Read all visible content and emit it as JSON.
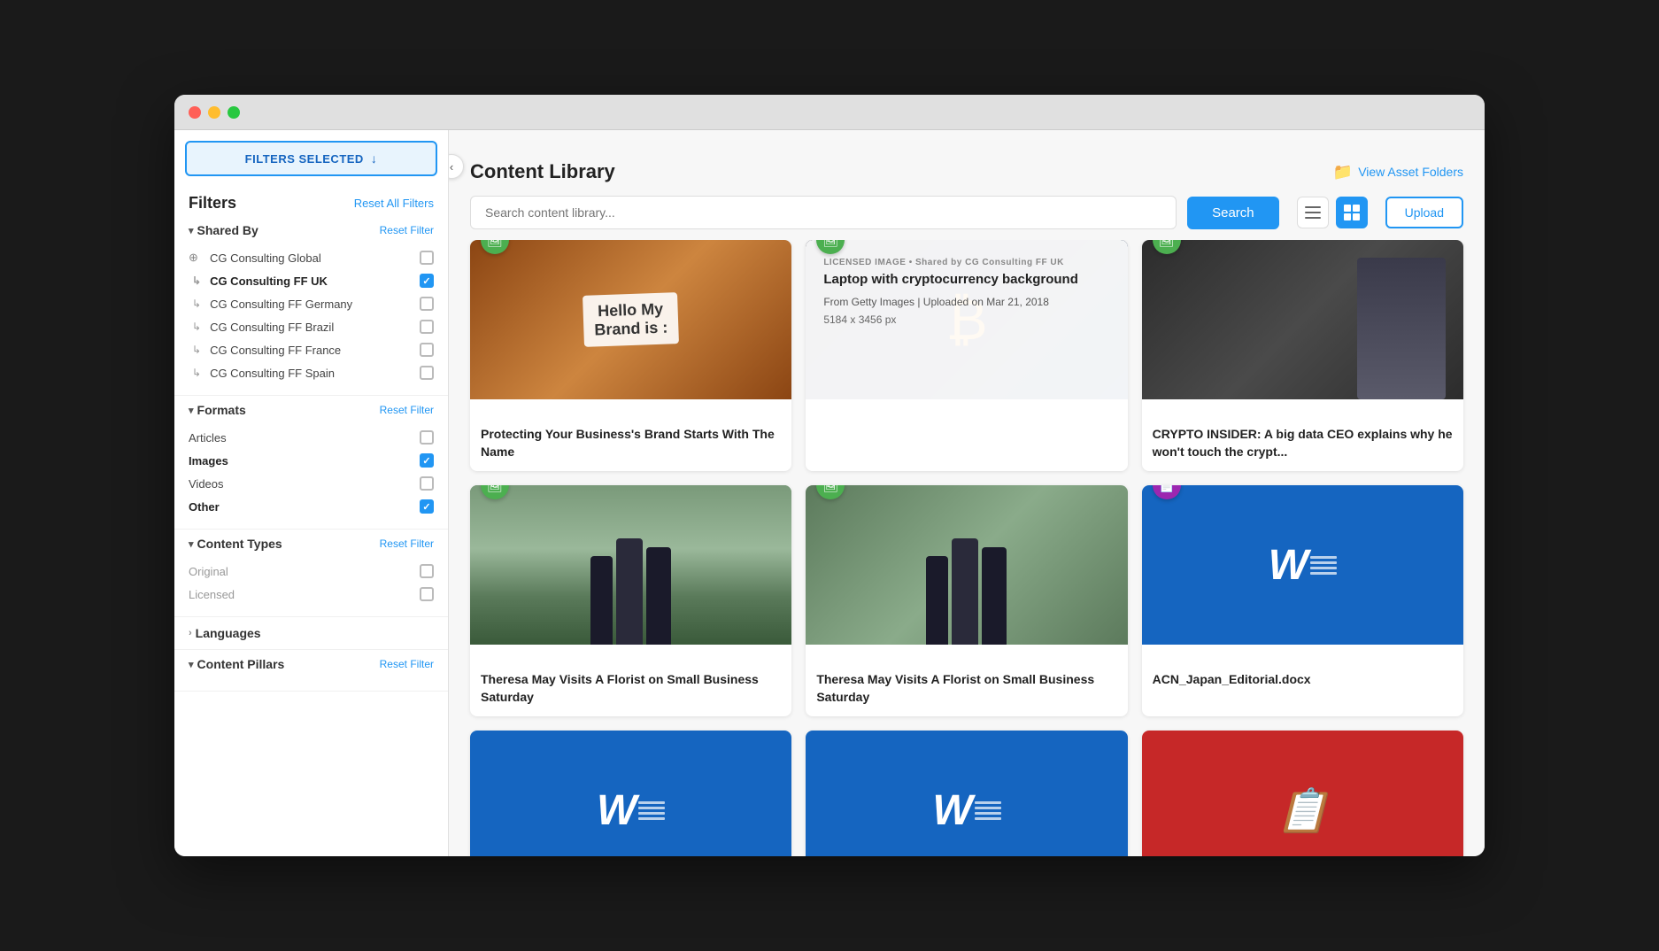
{
  "window": {
    "title": "Content Library"
  },
  "sidebar": {
    "filters_selected_label": "FILTERS SELECTED",
    "filters_title": "Filters",
    "reset_all_label": "Reset All Filters",
    "sections": {
      "shared_by": {
        "title": "Shared By",
        "reset_label": "Reset Filter",
        "items": [
          {
            "id": "cg-global",
            "label": "CG Consulting Global",
            "indent": false,
            "checked": false,
            "disabled": false,
            "has_globe": true
          },
          {
            "id": "cg-ff-uk",
            "label": "CG Consulting FF UK",
            "indent": true,
            "checked": true,
            "disabled": false,
            "has_globe": false
          },
          {
            "id": "cg-ff-germany",
            "label": "CG Consulting FF Germany",
            "indent": true,
            "checked": false,
            "disabled": false,
            "has_globe": false
          },
          {
            "id": "cg-ff-brazil",
            "label": "CG Consulting FF Brazil",
            "indent": true,
            "checked": false,
            "disabled": false,
            "has_globe": false
          },
          {
            "id": "cg-ff-france",
            "label": "CG Consulting FF France",
            "indent": true,
            "checked": false,
            "disabled": false,
            "has_globe": false
          },
          {
            "id": "cg-ff-spain",
            "label": "CG Consulting FF Spain",
            "indent": true,
            "checked": false,
            "disabled": false,
            "has_globe": false
          }
        ]
      },
      "formats": {
        "title": "Formats",
        "reset_label": "Reset Filter",
        "items": [
          {
            "id": "articles",
            "label": "Articles",
            "checked": false,
            "bold": false
          },
          {
            "id": "images",
            "label": "Images",
            "checked": true,
            "bold": true
          },
          {
            "id": "videos",
            "label": "Videos",
            "checked": false,
            "bold": false
          },
          {
            "id": "other",
            "label": "Other",
            "checked": true,
            "bold": true
          }
        ]
      },
      "content_types": {
        "title": "Content Types",
        "reset_label": "Reset Filter",
        "items": [
          {
            "id": "original",
            "label": "Original",
            "checked": false
          },
          {
            "id": "licensed",
            "label": "Licensed",
            "checked": false
          }
        ]
      },
      "languages": {
        "title": "Languages",
        "collapsed": true
      },
      "content_pillars": {
        "title": "Content Pillars",
        "reset_label": "Reset Filter"
      }
    }
  },
  "main": {
    "title": "Content Library",
    "view_asset_folders_label": "View Asset Folders",
    "search_placeholder": "Search content library...",
    "search_button_label": "Search",
    "upload_button_label": "Upload",
    "cards": [
      {
        "id": "card-1",
        "type": "image",
        "badge_color": "green",
        "title": "Protecting Your Business's Brand Starts With The Name",
        "subtitle": "",
        "image_type": "brand"
      },
      {
        "id": "card-2",
        "type": "image-hover",
        "badge_color": "green",
        "hover_tag": "LICENSED IMAGE • Shared by CG Consulting FF UK",
        "hover_title": "Laptop with cryptocurrency background",
        "hover_from": "From Getty Images | Uploaded on Mar 21, 2018",
        "hover_dimensions": "5184 x 3456 px",
        "image_type": "crypto"
      },
      {
        "id": "card-3",
        "type": "image",
        "badge_color": "green",
        "title": "CRYPTO INSIDER: A big data CEO explains why he won't touch the crypt...",
        "subtitle": "",
        "image_type": "dark-person"
      },
      {
        "id": "card-4",
        "type": "image",
        "badge_color": "green",
        "title": "Theresa May Visits A Florist on Small Business Saturday",
        "subtitle": "",
        "image_type": "street"
      },
      {
        "id": "card-5",
        "type": "image",
        "badge_color": "green",
        "title": "Theresa May Visits A Florist on Small Business Saturday",
        "subtitle": "",
        "image_type": "street2"
      },
      {
        "id": "card-6",
        "type": "word-doc",
        "badge_color": "purple",
        "title": "ACN_Japan_Editorial.docx",
        "bg_color": "blue"
      },
      {
        "id": "card-7",
        "type": "word-doc",
        "badge_color": "none",
        "title": "",
        "bg_color": "blue"
      },
      {
        "id": "card-8",
        "type": "word-doc",
        "badge_color": "none",
        "title": "",
        "bg_color": "blue"
      },
      {
        "id": "card-9",
        "type": "word-doc",
        "badge_color": "none",
        "title": "",
        "bg_color": "red"
      }
    ]
  }
}
